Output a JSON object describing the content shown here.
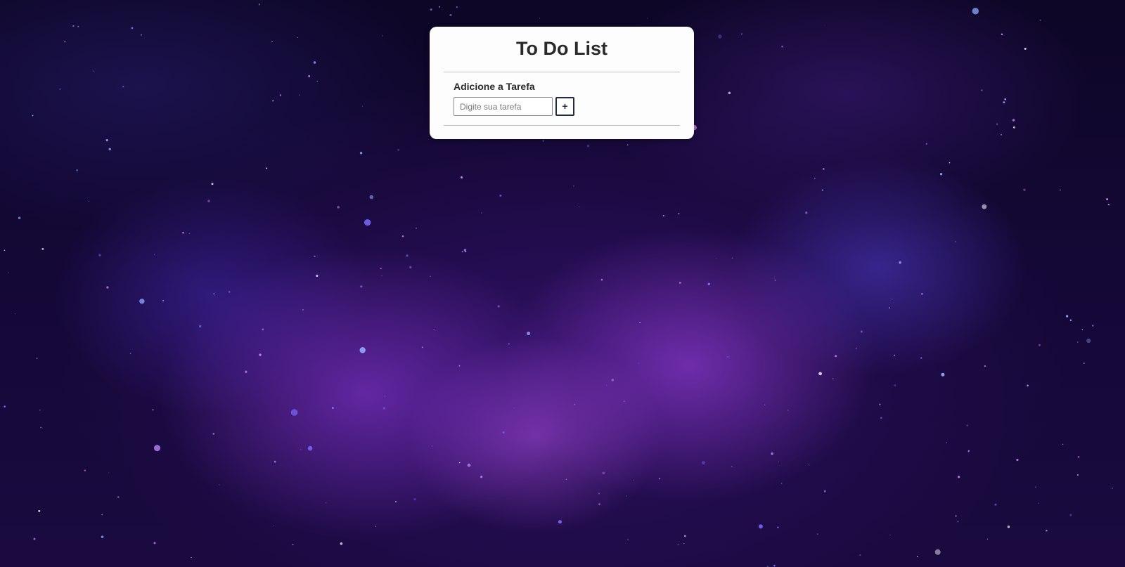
{
  "page": {
    "title": "To Do List"
  },
  "form": {
    "label": "Adicione a Tarefa",
    "input_placeholder": "Digite sua tarefa",
    "input_value": "",
    "add_button_label": "+"
  },
  "colors": {
    "card_background": "#fdfdfd",
    "title_text": "#2a2a2a",
    "button_border": "#1f2a44",
    "background_base": "#140836"
  }
}
